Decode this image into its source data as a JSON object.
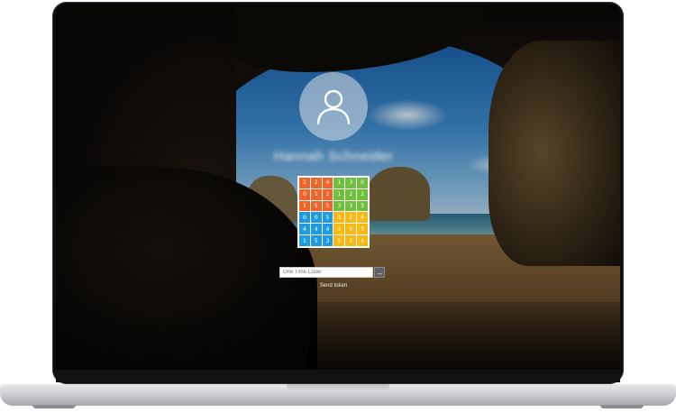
{
  "login": {
    "username": "Hannah Schneider",
    "otp_placeholder": "One Time Code",
    "submit_icon": "→",
    "send_token_label": "Send token"
  },
  "token_grid": {
    "rows": [
      [
        "1",
        "2",
        "4",
        "1",
        "3",
        "0"
      ],
      [
        "0",
        "1",
        "2",
        "1",
        "2",
        "2"
      ],
      [
        "1",
        "5",
        "5",
        "3",
        "3",
        "3"
      ],
      [
        "0",
        "0",
        "5",
        "3",
        "2",
        "4"
      ],
      [
        "4",
        "4",
        "4",
        "3",
        "0",
        "3"
      ],
      [
        "1",
        "5",
        "3",
        "5",
        "2",
        "4"
      ]
    ],
    "colors": {
      "orange": "#f0642a",
      "green": "#6fbf3c",
      "blue": "#1e9ae0",
      "yellow": "#f6b916"
    }
  },
  "icons": {
    "avatar": "user-silhouette-icon",
    "submit": "arrow-right-icon"
  }
}
